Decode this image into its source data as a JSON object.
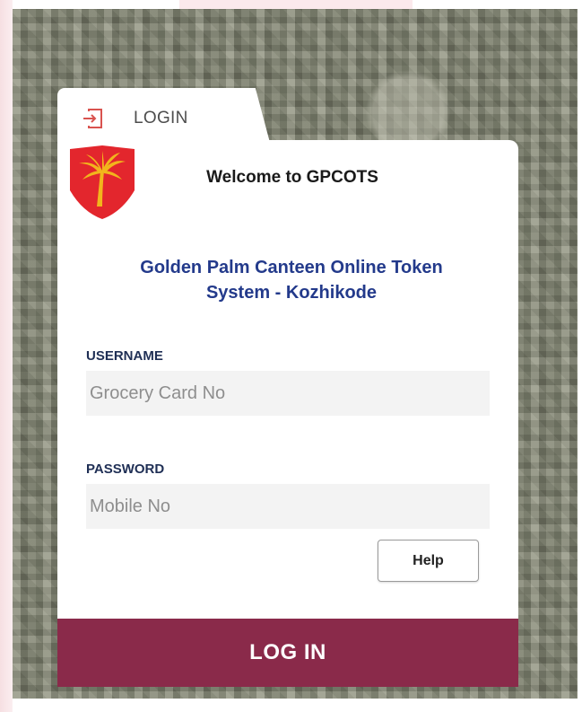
{
  "tab": {
    "label": "LOGIN"
  },
  "header": {
    "welcome": "Welcome to GPCOTS",
    "subtitle_line1": "Golden Palm Canteen Online Token",
    "subtitle_line2": "System - Kozhikode"
  },
  "form": {
    "username_label": "USERNAME",
    "username_placeholder": "Grocery Card No",
    "username_value": "",
    "password_label": "PASSWORD",
    "password_placeholder": "Mobile No",
    "password_value": "",
    "help_label": "Help",
    "login_label": "LOG IN"
  },
  "icons": {
    "tab_icon": "login-enter-icon",
    "emblem": "golden-palm-shield-emblem"
  },
  "colors": {
    "login_button": "#8a2a4a",
    "subtitle_text": "#233a8b",
    "emblem_red": "#e3262d",
    "emblem_gold": "#f2b51c"
  }
}
